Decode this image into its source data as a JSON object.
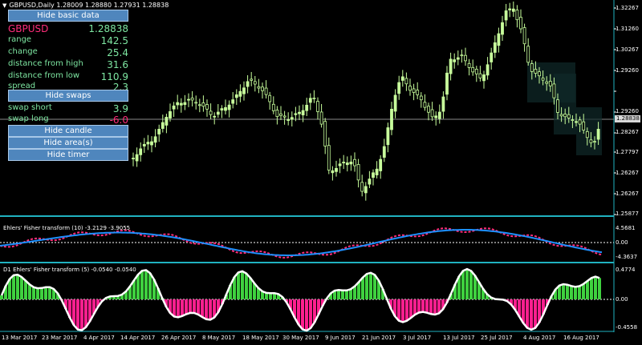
{
  "header": {
    "text": "GBPUSD,Daily  1.28009 1.28880 1.27931 1.28838"
  },
  "panel": {
    "hide_basic_label": "Hide basic data",
    "symbol": "GBPUSD",
    "price": "1.28838",
    "rows": [
      {
        "label": "range",
        "value": "142.5"
      },
      {
        "label": "change",
        "value": "25.4"
      },
      {
        "label": "distance from high",
        "value": "31.6"
      },
      {
        "label": "distance from low",
        "value": "110.9"
      },
      {
        "label": "spread",
        "value": "2.3"
      }
    ],
    "hide_swaps_label": "Hide swaps",
    "swap_short": {
      "label": "swap short",
      "value": "3.9"
    },
    "swap_long": {
      "label": "swap long",
      "value": "-6.0"
    },
    "hide_candle_label": "Hide candle",
    "hide_areas_label": "Hide area(s)",
    "hide_timer_label": "Hide timer"
  },
  "price_axis": {
    "labels": [
      "1.32267",
      "1.31260",
      "1.30267",
      "1.29260",
      "1.28838",
      "1.28267",
      "1.27797",
      "1.26267",
      "1.25877"
    ],
    "current": "1.28838"
  },
  "fisher1": {
    "title": "Ehlers' Fisher transform (10) -3.2129 -3.9055",
    "labels": [
      "4.5681",
      "0.00",
      "-4.3637"
    ]
  },
  "fisher2": {
    "title": "D1 Ehlers' Fisher transform (5) -0.0540 -0.0540",
    "labels": [
      "0.4774",
      "0.00",
      "-0.4558"
    ]
  },
  "time_axis": [
    "13 Mar 2017",
    "23 Mar 2017",
    "4 Apr 2017",
    "14 Apr 2017",
    "26 Apr 2017",
    "8 May 2017",
    "18 May 2017",
    "30 May 2017",
    "9 Jun 2017",
    "21 Jun 2017",
    "3 Jul 2017",
    "13 Jul 2017",
    "25 Jul 2017",
    "4 Aug 2017",
    "16 Aug 2017"
  ],
  "colors": {
    "candle": "#c8ff9c",
    "separator": "#20b2c0",
    "fisher_up": "#1e90ff",
    "fisher_down": "#ff2d7a",
    "hist_pos": "#3fd13f",
    "hist_neg": "#ff1f8f",
    "dashed": "#ffffff"
  }
}
